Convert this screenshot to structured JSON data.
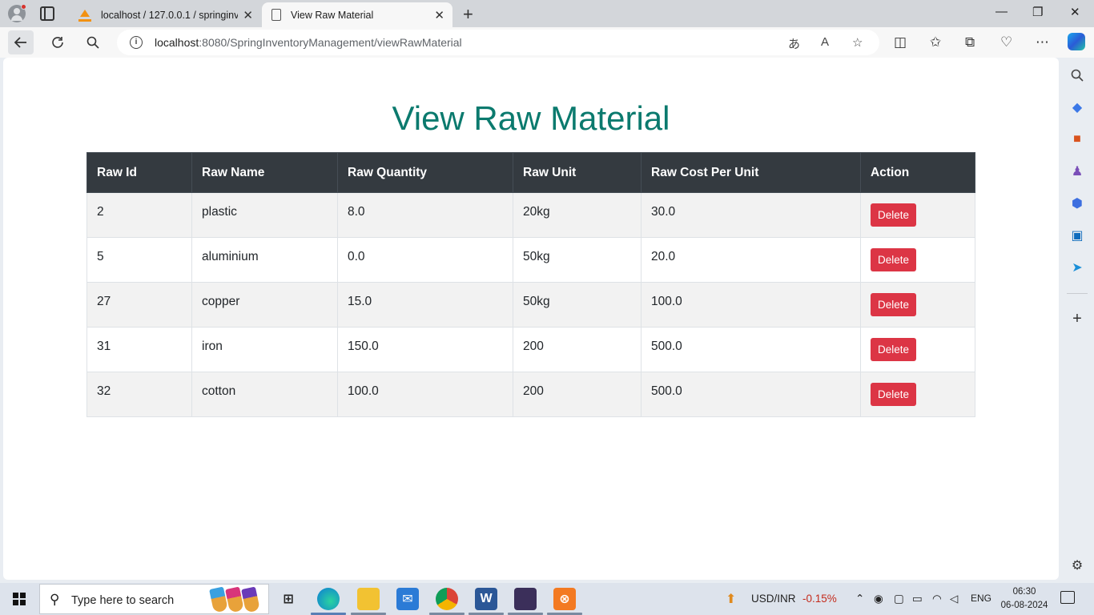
{
  "browser": {
    "tabs": [
      {
        "title": "localhost / 127.0.0.1 / springinventory",
        "close": "✕"
      },
      {
        "title": "View Raw Material",
        "close": "✕"
      }
    ],
    "new_tab": "+",
    "window_controls": {
      "minimize": "—",
      "restore": "❐",
      "close": "✕"
    },
    "url_host": "localhost",
    "url_path": ":8080/SpringInventoryManagement/viewRawMaterial"
  },
  "page": {
    "title": "View Raw Material",
    "columns": [
      "Raw Id",
      "Raw Name",
      "Raw Quantity",
      "Raw Unit",
      "Raw Cost Per Unit",
      "Action"
    ],
    "rows": [
      {
        "id": "2",
        "name": "plastic",
        "quantity": "8.0",
        "unit": "20kg",
        "cost": "30.0",
        "action": "Delete"
      },
      {
        "id": "5",
        "name": "aluminium",
        "quantity": "0.0",
        "unit": "50kg",
        "cost": "20.0",
        "action": "Delete"
      },
      {
        "id": "27",
        "name": "copper",
        "quantity": "15.0",
        "unit": "50kg",
        "cost": "100.0",
        "action": "Delete"
      },
      {
        "id": "31",
        "name": "iron",
        "quantity": "150.0",
        "unit": "200",
        "cost": "500.0",
        "action": "Delete"
      },
      {
        "id": "32",
        "name": "cotton",
        "quantity": "100.0",
        "unit": "200",
        "cost": "500.0",
        "action": "Delete"
      }
    ],
    "colors": {
      "title": "#0b7a6e",
      "header_bg": "#343a40",
      "delete_btn": "#dc3545"
    }
  },
  "taskbar": {
    "search_placeholder": "Type here to search",
    "ticker": "USD/INR",
    "ticker_change": "-0.15%",
    "language": "ENG",
    "time": "06:30",
    "date": "06-08-2024"
  }
}
